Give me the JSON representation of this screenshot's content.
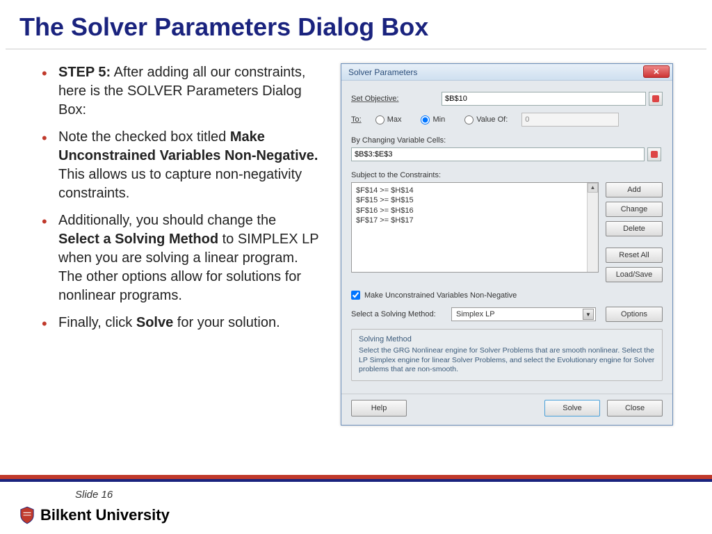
{
  "slide": {
    "title": "The Solver Parameters Dialog Box",
    "number": "Slide 16",
    "university": "Bilkent University"
  },
  "bullets": {
    "b1_strong": "STEP 5:",
    "b1_rest": " After adding all our constraints, here is the SOLVER Parameters Dialog Box:",
    "b2_pre": "Note the checked box titled ",
    "b2_strong": "Make Unconstrained Variables Non-Negative.",
    "b2_rest": " This allows us to capture non-negativity constraints.",
    "b3_pre": "Additionally, you should change the ",
    "b3_strong": "Select a Solving Method",
    "b3_rest": " to SIMPLEX LP when you are solving a linear program. The other options allow for solutions for nonlinear programs.",
    "b4_pre": "Finally, click ",
    "b4_strong": "Solve",
    "b4_rest": " for your solution."
  },
  "dialog": {
    "title": "Solver Parameters",
    "set_objective_lbl": "Set Objective:",
    "set_objective_val": "$B$10",
    "to_lbl": "To:",
    "radio_max": "Max",
    "radio_min": "Min",
    "radio_valueof": "Value Of:",
    "valueof_val": "0",
    "changing_lbl": "By Changing Variable Cells:",
    "changing_val": "$B$3:$E$3",
    "subject_lbl": "Subject to the Constraints:",
    "constraints": {
      "c1": "$F$14 >= $H$14",
      "c2": "$F$15 >= $H$15",
      "c3": "$F$16 >= $H$16",
      "c4": "$F$17 >= $H$17"
    },
    "btn_add": "Add",
    "btn_change": "Change",
    "btn_delete": "Delete",
    "btn_reset": "Reset All",
    "btn_loadsave": "Load/Save",
    "chk_label": "Make Unconstrained Variables Non-Negative",
    "method_lbl": "Select a Solving Method:",
    "method_val": "Simplex LP",
    "btn_options": "Options",
    "desc_title": "Solving Method",
    "desc_text": "Select the GRG Nonlinear engine for Solver Problems that are smooth nonlinear. Select the LP Simplex engine for linear Solver Problems, and select the Evolutionary engine for Solver problems that are non-smooth.",
    "btn_help": "Help",
    "btn_solve": "Solve",
    "btn_close": "Close"
  }
}
